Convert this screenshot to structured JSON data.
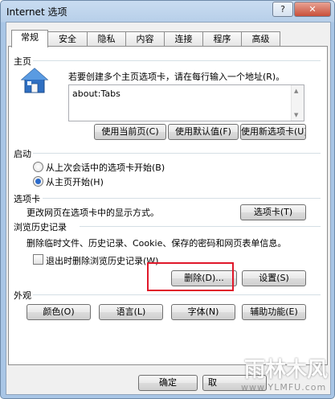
{
  "window": {
    "title": "Internet 选项",
    "help_glyph": "?",
    "close_glyph": "✕"
  },
  "tabs": [
    "常规",
    "安全",
    "隐私",
    "内容",
    "连接",
    "程序",
    "高级"
  ],
  "homepage": {
    "group_label": "主页",
    "instruction": "若要创建多个主页选项卡，请在每行输入一个地址(R)。",
    "value": "about:Tabs",
    "use_current": "使用当前页(C)",
    "use_default": "使用默认值(F)",
    "use_new_tab": "使用新选项卡(U)"
  },
  "startup": {
    "group_label": "启动",
    "option1": "从上次会话中的选项卡开始(B)",
    "option2": "从主页开始(H)",
    "selected": 2
  },
  "tabs_group": {
    "group_label": "选项卡",
    "description": "更改网页在选项卡中的显示方式。",
    "button": "选项卡(T)"
  },
  "history": {
    "group_label": "浏览历史记录",
    "description": "删除临时文件、历史记录、Cookie、保存的密码和网页表单信息。",
    "checkbox_label": "退出时删除浏览历史记录(W)",
    "checkbox_checked": false,
    "delete_button": "删除(D)...",
    "settings_button": "设置(S)"
  },
  "appearance": {
    "group_label": "外观",
    "colors": "颜色(O)",
    "languages": "语言(L)",
    "fonts": "字体(N)",
    "accessibility": "辅助功能(E)"
  },
  "footer": {
    "ok": "确定",
    "cancel": "取"
  },
  "watermark": {
    "title": "雨林木风",
    "url": "www.YLMFU.com"
  },
  "colors": {
    "highlight": "#e0182a",
    "accent": "#2a6acb"
  }
}
